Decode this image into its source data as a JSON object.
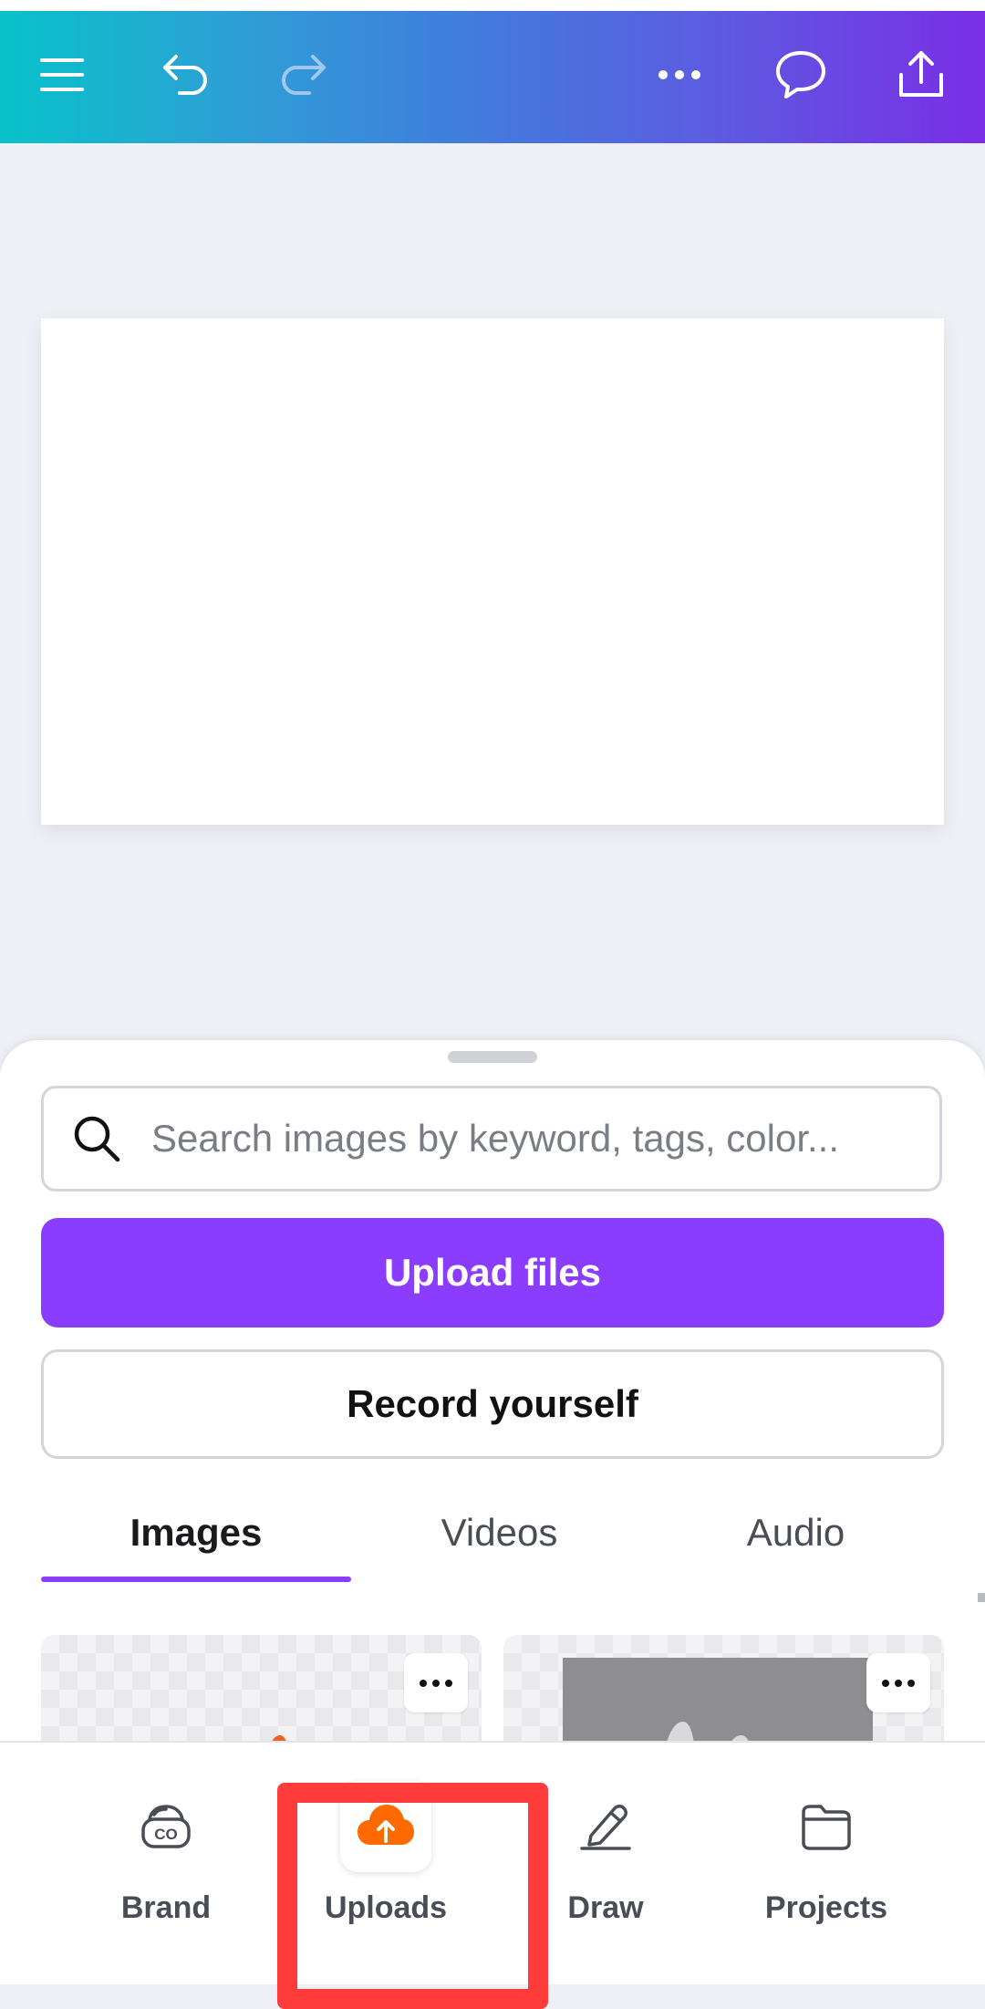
{
  "topbar": {
    "gradient_start": "#08c2c9",
    "gradient_end": "#7a2ee6",
    "icons": [
      "menu-icon",
      "undo-icon",
      "redo-icon",
      "more-horizontal-icon",
      "comment-icon",
      "share-icon"
    ]
  },
  "panel": {
    "search_placeholder": "Search images by keyword, tags, color...",
    "upload_button": "Upload files",
    "record_button": "Record yourself",
    "tabs": [
      {
        "label": "Images",
        "active": true
      },
      {
        "label": "Videos",
        "active": false
      },
      {
        "label": "Audio",
        "active": false
      }
    ],
    "accent": "#8b3dff"
  },
  "bottom_nav": {
    "items": [
      {
        "label": "Brand",
        "icon": "brand-icon"
      },
      {
        "label": "Uploads",
        "icon": "cloud-upload-icon",
        "active": true
      },
      {
        "label": "Draw",
        "icon": "pen-icon"
      },
      {
        "label": "Projects",
        "icon": "folder-icon"
      }
    ],
    "highlight_color": "#ff3b3b",
    "uploads_icon_color": "#ff6a00"
  }
}
